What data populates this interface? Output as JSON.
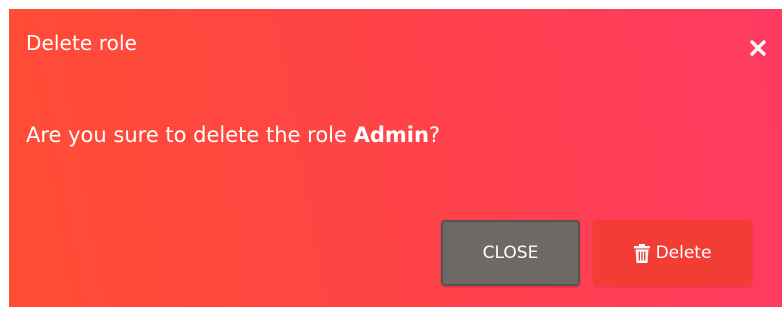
{
  "modal": {
    "title": "Delete role",
    "close_icon": "close-icon",
    "body_prefix": "Are you sure to delete the role ",
    "role_name": "Admin",
    "body_suffix": "?",
    "close_button_label": "CLOSE",
    "delete_button_label": "Delete",
    "delete_icon": "trash-icon",
    "colors": {
      "gradient_start": "#ff4d33",
      "gradient_end": "#ff3a62",
      "close_button": "#6d6967",
      "delete_button": "#f23d35",
      "text": "#ffffff"
    }
  }
}
